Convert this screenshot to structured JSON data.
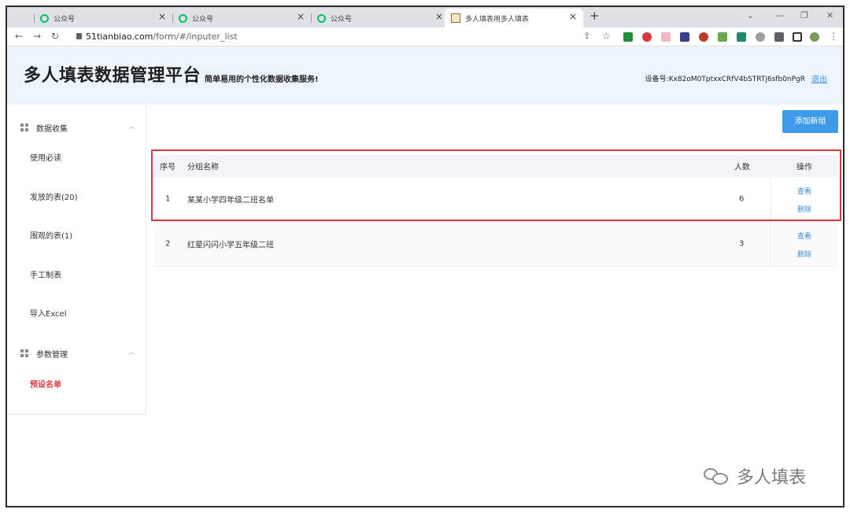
{
  "browser": {
    "tabs": [
      {
        "label": "公众号"
      },
      {
        "label": "公众号"
      },
      {
        "label": "公众号"
      },
      {
        "label": "多人填表用多人填表"
      }
    ],
    "new_tab": "+",
    "url_host": "51tianbiao.com",
    "url_path": "/form/#/inputer_list"
  },
  "header": {
    "title": "多人填表数据管理平台",
    "subtitle": "简单易用的个性化数据收集服务!",
    "device_label": "设备号:Kx82oM0TptxxCRfV4bSTRTj6sfb0nPgR",
    "logout": "退出"
  },
  "sidebar": {
    "group1": "数据收集",
    "items1": [
      "使用必读",
      "发放的表(20)",
      "围观的表(1)",
      "手工制表",
      "导入Excel"
    ],
    "group2": "参数管理",
    "items2": [
      "预设名单"
    ]
  },
  "main": {
    "add_button": "添加新组",
    "columns": {
      "index": "序号",
      "name": "分组名称",
      "count": "人数",
      "ops": "操作"
    },
    "rows": [
      {
        "index": "1",
        "name": "某某小学四年级二班名单",
        "count": "6",
        "view": "查看",
        "delete": "删除"
      },
      {
        "index": "2",
        "name": "红星闪闪小学五年级二班",
        "count": "3",
        "view": "查看",
        "delete": "删除"
      }
    ]
  },
  "watermark": "多人填表",
  "colors": {
    "accent": "#3d9be9",
    "highlight_box": "#d9363e",
    "active_menu": "#e0393e",
    "header_bg": "#edf5fc"
  }
}
